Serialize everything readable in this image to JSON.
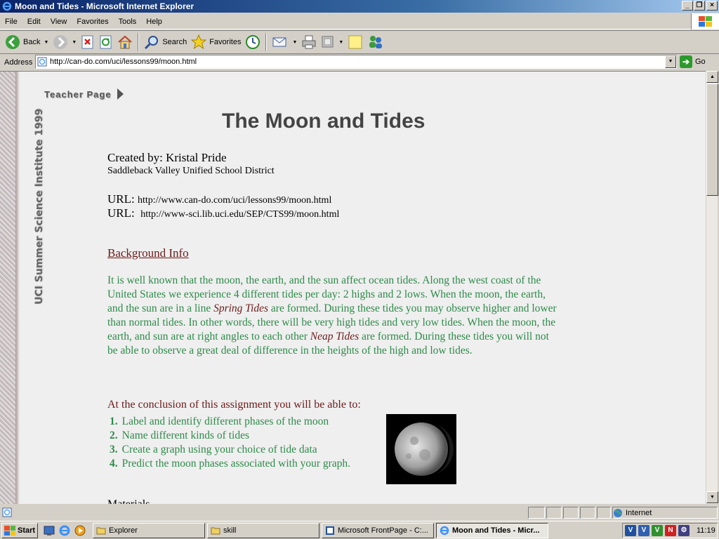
{
  "window": {
    "title": "Moon and Tides - Microsoft Internet Explorer"
  },
  "menu": [
    "File",
    "Edit",
    "View",
    "Favorites",
    "Tools",
    "Help"
  ],
  "toolbar": {
    "back": "Back",
    "search": "Search",
    "favorites": "Favorites"
  },
  "address": {
    "label": "Address",
    "url": "http://can-do.com/uci/lessons99/moon.html",
    "go": "Go"
  },
  "page": {
    "teacher_link": "Teacher Page",
    "side_banner": "UCI Summer Science Institute 1999",
    "title": "The Moon and Tides",
    "created_by": "Created by: Kristal Pride",
    "district": "Saddleback Valley Unified School District",
    "url_label": "URL:",
    "url1": "http://www.can-do.com/uci/lessons99/moon.html",
    "url2": "http://www-sci.lib.uci.edu/SEP/CTS99/moon.html",
    "background_heading": "Background Info",
    "background_p1": "It is well known that the moon, the earth, and the sun affect ocean tides.  Along the west coast of the United States we experience 4 different tides per day: 2 highs and 2 lows.  When the moon, the earth, and the sun are in a line ",
    "spring_tides": "Spring Tides",
    "background_p2": " are formed.  During these tides you may observe higher and lower than normal tides.  In other words, there will be very high tides and very low tides.  When the moon, the earth, and sun are at right angles to each other ",
    "neap_tides": "Neap Tides",
    "background_p3": " are formed.  During these tides you will not be able to observe a great deal of difference in the heights of the high and low tides.",
    "conclusion": "At the conclusion of this assignment you will be able to:",
    "objectives": [
      {
        "num": "1.",
        "text": "Label and identify different phases of the  moon"
      },
      {
        "num": "2.",
        "text": "Name different kinds of tides"
      },
      {
        "num": "3.",
        "text": "Create a graph using your choice of tide data"
      },
      {
        "num": "4.",
        "text": "Predict the moon phases associated with your graph."
      }
    ],
    "materials_partial": "Materials"
  },
  "status": {
    "zone": "Internet"
  },
  "taskbar": {
    "start": "Start",
    "buttons": [
      "Explorer",
      "skill",
      "Microsoft FrontPage - C:...",
      "Moon and Tides - Micr..."
    ],
    "clock": "11:19"
  }
}
